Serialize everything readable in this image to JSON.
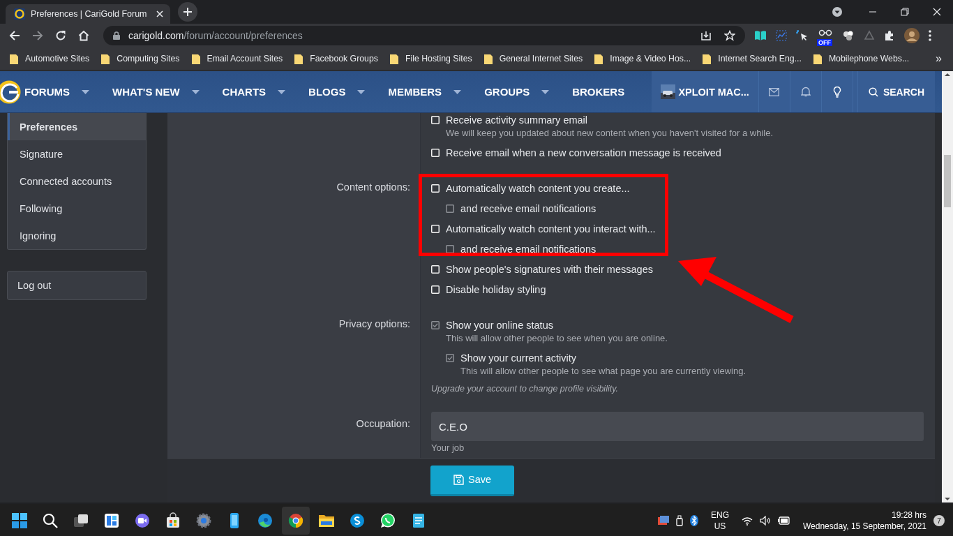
{
  "browser": {
    "tab_title": "Preferences | CariGold Forum",
    "url_host": "carigold.com",
    "url_path": "/forum/account/preferences",
    "extension_badge": "OFF",
    "bookmarks": [
      "Automotive Sites",
      "Computing Sites",
      "Email Account Sites",
      "Facebook Groups",
      "File Hosting Sites",
      "General Internet Sites",
      "Image & Video Hos...",
      "Internet Search Eng...",
      "Mobilephone Webs..."
    ],
    "bookmarks_overflow": "»"
  },
  "nav": {
    "items": [
      {
        "label": "FORUMS",
        "has_menu": true
      },
      {
        "label": "WHAT'S NEW",
        "has_menu": true
      },
      {
        "label": "CHARTS",
        "has_menu": true
      },
      {
        "label": "BLOGS",
        "has_menu": true
      },
      {
        "label": "MEMBERS",
        "has_menu": true
      },
      {
        "label": "GROUPS",
        "has_menu": true
      },
      {
        "label": "BROKERS",
        "has_menu": false
      }
    ],
    "user": "XPLOIT MAC...",
    "search": "SEARCH"
  },
  "sidebar": {
    "items": [
      {
        "label": "Preferences",
        "selected": true
      },
      {
        "label": "Signature",
        "selected": false
      },
      {
        "label": "Connected accounts",
        "selected": false
      },
      {
        "label": "Following",
        "selected": false
      },
      {
        "label": "Ignoring",
        "selected": false
      }
    ],
    "logout": "Log out"
  },
  "form": {
    "sections": [
      {
        "options": [
          {
            "label": "Receive activity summary email",
            "hint": "We will keep you updated about new content when you haven't visited for a while.",
            "checked": false,
            "disabled": false
          },
          {
            "label": "Receive email when a new conversation message is received",
            "checked": false,
            "disabled": false
          }
        ]
      },
      {
        "label": "Content options:",
        "options": [
          {
            "label": "Automatically watch content you create...",
            "checked": false,
            "disabled": false,
            "children": [
              {
                "label": "and receive email notifications",
                "checked": false,
                "disabled": true
              }
            ]
          },
          {
            "label": "Automatically watch content you interact with...",
            "checked": false,
            "disabled": false,
            "children": [
              {
                "label": "and receive email notifications",
                "checked": false,
                "disabled": true
              }
            ]
          },
          {
            "label": "Show people's signatures with their messages",
            "checked": false,
            "disabled": false
          },
          {
            "label": "Disable holiday styling",
            "checked": false,
            "disabled": false
          }
        ]
      },
      {
        "label": "Privacy options:",
        "options": [
          {
            "label": "Show your online status",
            "hint": "This will allow other people to see when you are online.",
            "checked": true,
            "disabled": true,
            "children": [
              {
                "label": "Show your current activity",
                "hint": "This will allow other people to see what page you are currently viewing.",
                "checked": true,
                "disabled": true
              }
            ]
          }
        ],
        "note": "Upgrade your account to change profile visibility."
      }
    ],
    "occupation": {
      "label": "Occupation:",
      "value": "C.E.O",
      "hint": "Your job"
    },
    "save": "Save"
  },
  "taskbar": {
    "language": "ENG",
    "region": "US",
    "time": "19:28 hrs",
    "date": "Wednesday, 15 September, 2021",
    "notifications": "7"
  }
}
